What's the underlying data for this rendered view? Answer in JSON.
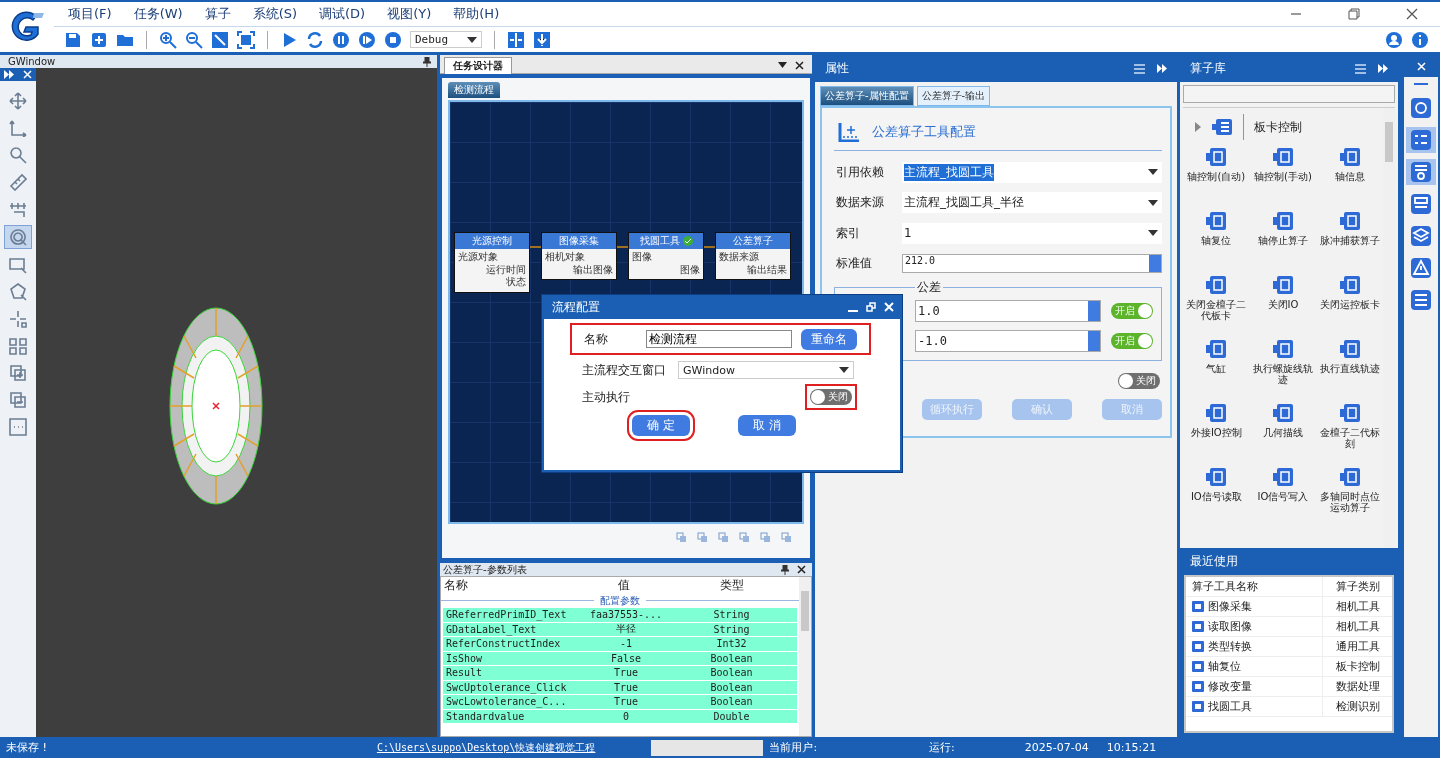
{
  "menu": [
    "项目(F)",
    "任务(W)",
    "算子",
    "系统(S)",
    "调试(D)",
    "视图(Y)",
    "帮助(H)"
  ],
  "run_mode": "Debug",
  "gwindow": {
    "title": "GWindow",
    "tools": [
      {
        "selected": false
      },
      {
        "selected": false
      },
      {
        "selected": false
      },
      {
        "selected": false
      },
      {
        "selected": false
      },
      {
        "selected": true
      },
      {
        "selected": false
      },
      {
        "selected": false
      },
      {
        "selected": false
      },
      {
        "selected": false
      },
      {
        "selected": false
      },
      {
        "selected": false
      },
      {
        "selected": false
      }
    ]
  },
  "designer": {
    "tab": "任务设计器",
    "flow_tab": "检测流程",
    "nodes": [
      {
        "title": "光源控制",
        "left": [
          "光源对象"
        ],
        "right": [
          "运行时间",
          "状态"
        ],
        "done": false
      },
      {
        "title": "图像采集",
        "left": [
          "相机对象"
        ],
        "right": [
          "输出图像"
        ],
        "done": false
      },
      {
        "title": "找圆工具",
        "left": [
          "图像"
        ],
        "right": [
          "图像"
        ],
        "done": true
      },
      {
        "title": "公差算子",
        "left": [
          "数据来源"
        ],
        "right": [
          "输出结果"
        ],
        "done": false
      }
    ]
  },
  "params": {
    "title": "公差算子-参数列表",
    "columns": [
      "名称",
      "值",
      "类型"
    ],
    "group": "配置参数",
    "rows": [
      {
        "name": "GReferredPrimID_Text",
        "value": "faa37553-...",
        "type": "String"
      },
      {
        "name": "GDataLabel_Text",
        "value": "半径",
        "type": "String"
      },
      {
        "name": "ReferConstructIndex",
        "value": "-1",
        "type": "Int32"
      },
      {
        "name": "IsShow",
        "value": "False",
        "type": "Boolean"
      },
      {
        "name": "Result",
        "value": "True",
        "type": "Boolean"
      },
      {
        "name": "SwcUptolerance_Click",
        "value": "True",
        "type": "Boolean"
      },
      {
        "name": "SwcLowtolerance_C...",
        "value": "True",
        "type": "Boolean"
      },
      {
        "name": "Standardvalue",
        "value": "0",
        "type": "Double"
      }
    ]
  },
  "properties": {
    "title": "属性",
    "tabs": [
      {
        "label": "公差算子-属性配置",
        "selected": true
      },
      {
        "label": "公差算子-输出",
        "selected": false
      }
    ],
    "heading": "公差算子工具配置",
    "fields": [
      {
        "label": "引用依赖",
        "value": "主流程_找圆工具",
        "highlighted": true
      },
      {
        "label": "数据来源",
        "value": "主流程_找圆工具_半径",
        "highlighted": false
      },
      {
        "label": "索引",
        "value": "1",
        "highlighted": false
      }
    ],
    "standard": {
      "label": "标准值",
      "value": "212.0"
    },
    "tolerance": {
      "legend": "公差",
      "rows": [
        {
          "value": "1.0",
          "switch": "开启",
          "on": true
        },
        {
          "value": "-1.0",
          "switch": "开启",
          "on": true
        }
      ]
    },
    "extra_switch": {
      "label": "关闭",
      "on": false
    },
    "buttons": [
      {
        "label": "循环执行",
        "disabled": true
      },
      {
        "label": "确认",
        "disabled": true
      },
      {
        "label": "取消",
        "disabled": true
      }
    ]
  },
  "library": {
    "title": "算子库",
    "category": "板卡控制",
    "items": [
      "轴控制(自动)",
      "轴控制(手动)",
      "轴信息",
      "轴复位",
      "轴停止算子",
      "脉冲捕获算子",
      "关闭金檀子二代板卡",
      "关闭IO",
      "关闭运控板卡",
      "气缸",
      "执行螺旋线轨迹",
      "执行直线轨迹",
      "外接IO控制",
      "几何描线",
      "金檀子二代标刻",
      "IO信号读取",
      "IO信号写入",
      "多轴同时点位运动算子"
    ]
  },
  "side_tools": [
    {
      "selected": false
    },
    {
      "selected": true
    },
    {
      "selected": true
    },
    {
      "selected": false
    },
    {
      "selected": false
    },
    {
      "selected": false
    },
    {
      "selected": false
    }
  ],
  "recent": {
    "title": "最近使用",
    "columns": [
      "算子工具名称",
      "算子类别"
    ],
    "rows": [
      {
        "name": "图像采集",
        "category": "相机工具"
      },
      {
        "name": "读取图像",
        "category": "相机工具"
      },
      {
        "name": "类型转换",
        "category": "通用工具"
      },
      {
        "name": "轴复位",
        "category": "板卡控制"
      },
      {
        "name": "修改变量",
        "category": "数据处理"
      },
      {
        "name": "找圆工具",
        "category": "检测识别"
      }
    ]
  },
  "dialog": {
    "title": "流程配置",
    "name_label": "名称",
    "name_value": "检测流程",
    "rename": "重命名",
    "name_highlighted": true,
    "window_label": "主流程交互窗口",
    "window_value": "GWindow",
    "auto_label": "主动执行",
    "auto_switch": {
      "label": "关闭",
      "on": false,
      "highlighted": true
    },
    "ok": {
      "label": "确 定",
      "highlighted": true
    },
    "cancel": {
      "label": "取 消",
      "highlighted": false
    }
  },
  "status": {
    "save_state": "未保存 !",
    "path": "C:\\Users\\suppo\\Desktop\\快速创建视觉工程",
    "user_label": "当前用户:",
    "run_label": "运行:",
    "date": "2025-07-04",
    "time": "10:15:21"
  }
}
